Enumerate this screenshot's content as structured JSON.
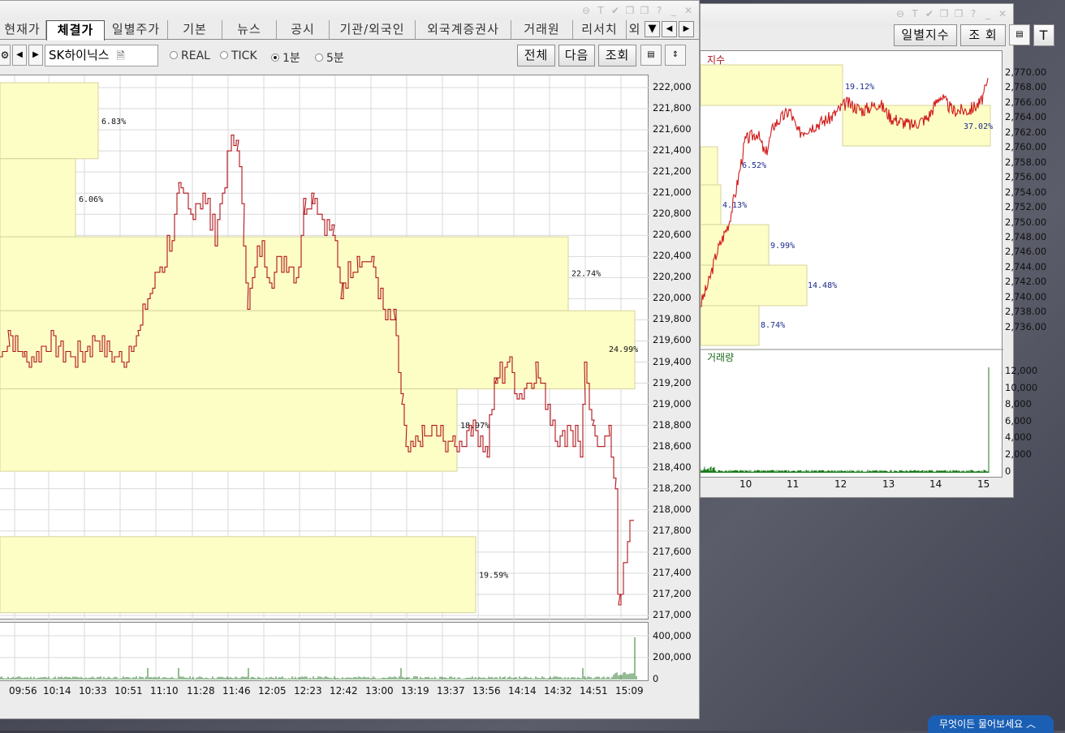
{
  "main_window": {
    "tabs": [
      "현재가",
      "체결가",
      "일별주가",
      "기본",
      "뉴스",
      "공시",
      "기관/외국인",
      "외국계증권사",
      "거래원",
      "리서치",
      "외"
    ],
    "active_tab": 1,
    "tab_more_icon": "triangle-down-icon",
    "stock_name": "SK하이닉스",
    "radio_options": [
      "REAL",
      "TICK",
      "1분",
      "5분"
    ],
    "radio_selected": "1분",
    "buttons": {
      "all": "전체",
      "next": "다음",
      "query": "조회"
    },
    "price_axis": [
      "222,000",
      "221,800",
      "221,600",
      "221,400",
      "221,200",
      "221,000",
      "220,800",
      "220,600",
      "220,400",
      "220,200",
      "220,000",
      "219,800",
      "219,600",
      "219,400",
      "219,200",
      "219,000",
      "218,800",
      "218,600",
      "218,400",
      "218,200",
      "218,000",
      "217,800",
      "217,600",
      "217,400",
      "217,200",
      "217,000"
    ],
    "volume_axis": [
      "400,000",
      "200,000",
      "0"
    ],
    "time_axis": [
      "09:56",
      "10:14",
      "10:33",
      "10:51",
      "11:10",
      "11:28",
      "11:46",
      "12:05",
      "12:23",
      "12:42",
      "13:00",
      "13:19",
      "13:37",
      "13:56",
      "14:14",
      "14:32",
      "14:51",
      "15:09"
    ],
    "volume_profile": [
      {
        "label": "6.83%"
      },
      {
        "label": "6.06%"
      },
      {
        "label": "22.74%"
      },
      {
        "label": "24.99%"
      },
      {
        "label": "18.97%"
      },
      {
        "label": "19.59%"
      }
    ],
    "line_color": "#b0141a"
  },
  "index_window": {
    "buttons": {
      "daily_index": "일별지수",
      "query": "조 회",
      "tool": "T"
    },
    "chart_title": "지수",
    "volume_title": "거래량",
    "price_axis": [
      "2,770.00",
      "2,768.00",
      "2,766.00",
      "2,764.00",
      "2,762.00",
      "2,760.00",
      "2,758.00",
      "2,756.00",
      "2,754.00",
      "2,752.00",
      "2,750.00",
      "2,748.00",
      "2,746.00",
      "2,744.00",
      "2,742.00",
      "2,740.00",
      "2,738.00",
      "2,736.00"
    ],
    "volume_axis": [
      "12,000",
      "10,000",
      "8,000",
      "6,000",
      "4,000",
      "2,000",
      "0"
    ],
    "time_axis": [
      "10",
      "11",
      "12",
      "13",
      "14",
      "15"
    ],
    "volume_profile": [
      {
        "label": "19.12%"
      },
      {
        "label": "37.02%"
      },
      {
        "label": "6.52%"
      },
      {
        "label": "4.13%"
      },
      {
        "label": "9.99%"
      },
      {
        "label": "14.48%"
      },
      {
        "label": "8.74%"
      }
    ],
    "line_color": "#d11b1b",
    "volume_color": "#1a7a1a"
  },
  "ai_chip": "무엇이든 물어보세요"
}
